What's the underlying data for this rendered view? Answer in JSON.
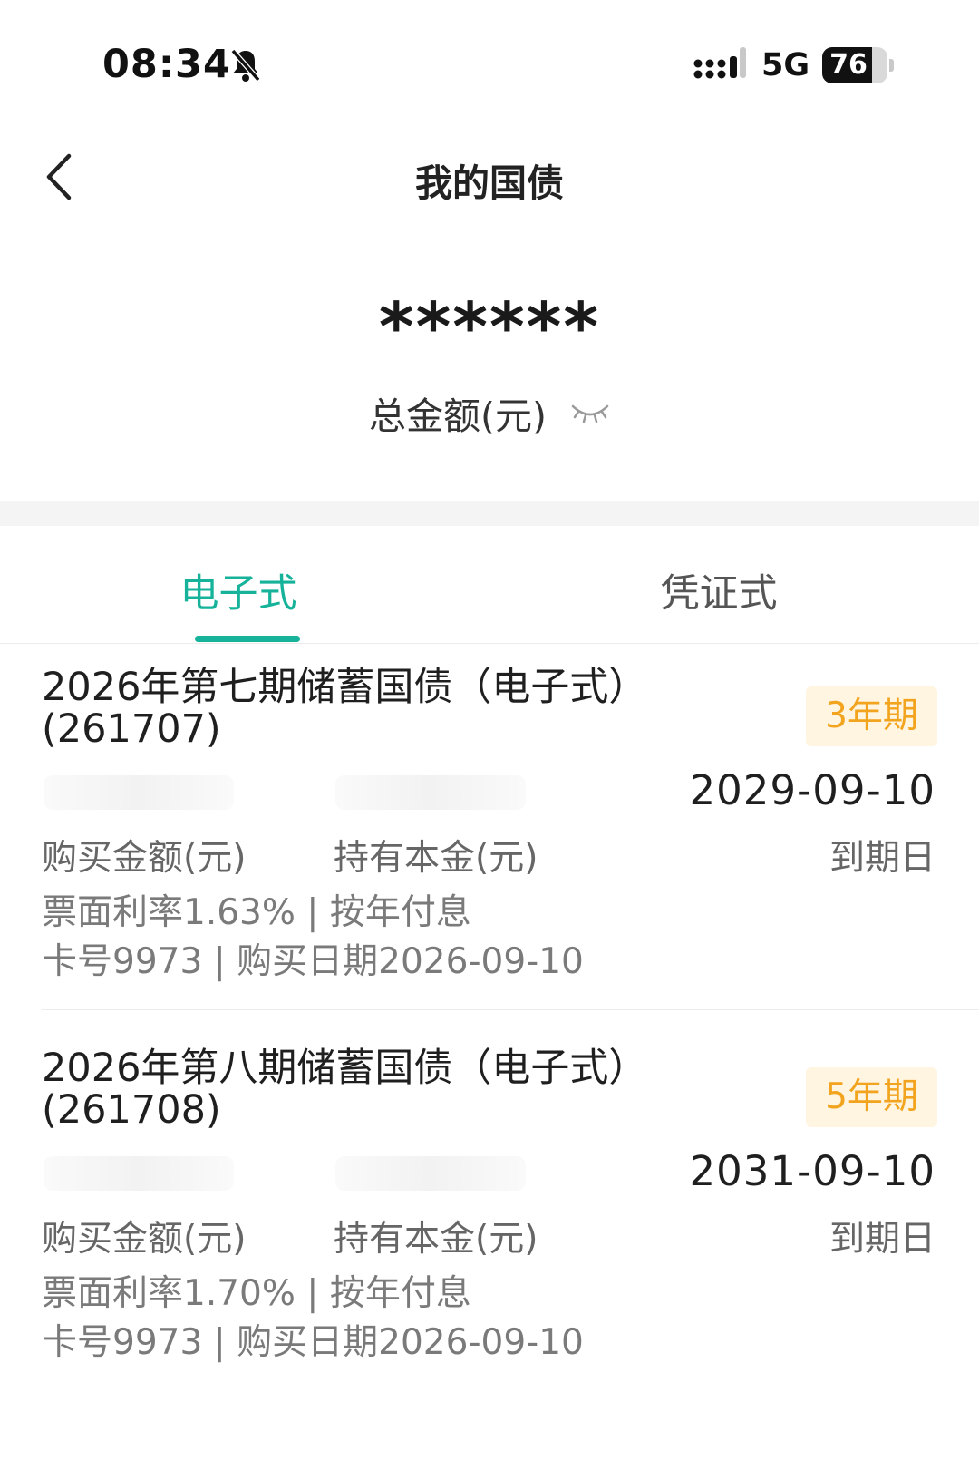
{
  "status_bar": {
    "time": "08:34",
    "network": "5G",
    "battery_level": "76",
    "battery_fraction": 0.76
  },
  "header": {
    "title": "我的国债"
  },
  "summary": {
    "total_amount_masked": "******",
    "total_amount_label": "总金额(元)"
  },
  "tabs": [
    {
      "label": "电子式",
      "active": true
    },
    {
      "label": "凭证式",
      "active": false
    }
  ],
  "colors": {
    "accent": "#16b39a",
    "badge_text": "#f2a41f",
    "badge_bg": "#fff5e0"
  },
  "bonds": [
    {
      "title": "2026年第七期储蓄国债（电子式）(261707)",
      "term": "3年期",
      "maturity_date": "2029-09-10",
      "maturity_label": "到期日",
      "purchase_amount_label": "购买金额(元)",
      "principal_label": "持有本金(元)",
      "coupon_line": "票面利率1.63% | 按年付息",
      "card_line": "卡号9973 | 购买日期2026-09-10"
    },
    {
      "title": "2026年第八期储蓄国债（电子式）(261708)",
      "term": "5年期",
      "maturity_date": "2031-09-10",
      "maturity_label": "到期日",
      "purchase_amount_label": "购买金额(元)",
      "principal_label": "持有本金(元)",
      "coupon_line": "票面利率1.70% | 按年付息",
      "card_line": "卡号9973 | 购买日期2026-09-10"
    }
  ]
}
